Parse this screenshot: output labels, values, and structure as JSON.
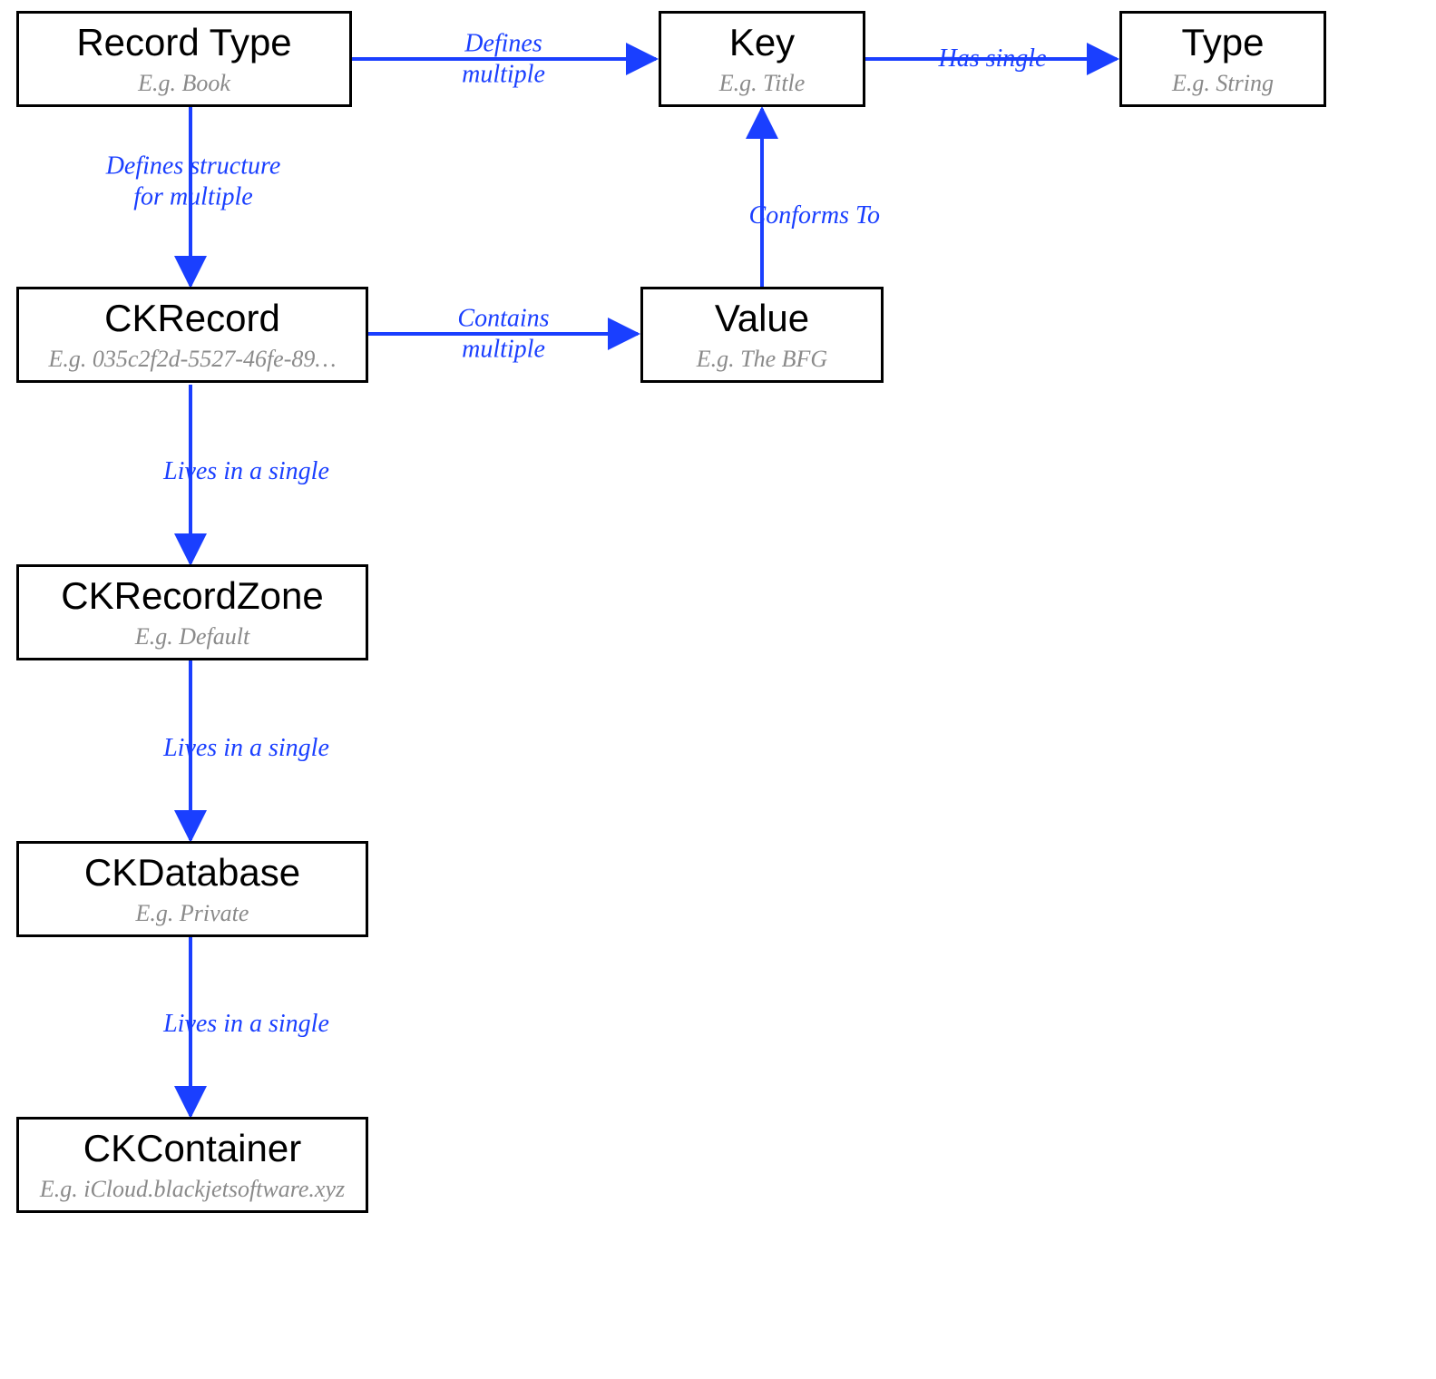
{
  "nodes": {
    "recordType": {
      "title": "Record Type",
      "sub": "E.g. Book"
    },
    "key": {
      "title": "Key",
      "sub": "E.g. Title"
    },
    "type": {
      "title": "Type",
      "sub": "E.g. String"
    },
    "ckRecord": {
      "title": "CKRecord",
      "sub": "E.g. 035c2f2d-5527-46fe-89…"
    },
    "value": {
      "title": "Value",
      "sub": "E.g. The BFG"
    },
    "ckRecordZone": {
      "title": "CKRecordZone",
      "sub": "E.g. Default"
    },
    "ckDatabase": {
      "title": "CKDatabase",
      "sub": "E.g. Private"
    },
    "ckContainer": {
      "title": "CKContainer",
      "sub": "E.g. iCloud.blackjetsoftware.xyz"
    }
  },
  "edges": {
    "rt_key": "Defines\nmultiple",
    "key_type": "Has single",
    "rt_record": "Defines structure\nfor multiple",
    "record_value": "Contains\nmultiple",
    "value_key": "Conforms To",
    "record_zone": "Lives in a single",
    "zone_db": "Lives in a single",
    "db_container": "Lives in a single"
  },
  "colors": {
    "edge": "#1a3fff",
    "nodeBorder": "#000000",
    "subText": "#8a8a8a"
  }
}
